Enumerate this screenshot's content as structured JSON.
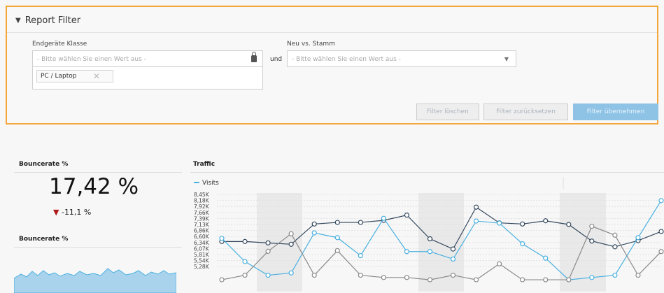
{
  "filter": {
    "title": "Report Filter",
    "endgeraete_label": "Endgeräte Klasse",
    "endgeraete_placeholder": "- Bitte wählen Sie einen Wert aus -",
    "endgeraete_chip": "PC / Laptop",
    "und_label": "und",
    "neu_label": "Neu vs. Stamm",
    "neu_placeholder": "- Bitte wählen Sie einen Wert aus -",
    "buttons": {
      "clear": "Filter löschen",
      "reset": "Filter zurücksetzen",
      "apply": "Filter übernehmen"
    }
  },
  "bounce_card": {
    "title": "Bouncerate %",
    "value": "17,42 %",
    "delta": "-11,1 %"
  },
  "bounce_mini": {
    "title": "Bouncerate %"
  },
  "traffic_card": {
    "title": "Traffic",
    "legend": "Visits"
  },
  "colors": {
    "accent_border": "#f4a63a",
    "series_dark": "#34495e",
    "series_blue": "#4ab0e0",
    "series_gray": "#8a8a8a",
    "delta_down": "#b01a1a"
  },
  "chart_data": {
    "type": "line",
    "title": "Traffic",
    "y_ticks": [
      "8,45K",
      "8,18K",
      "7,92K",
      "7,66K",
      "7,39K",
      "7,13K",
      "6,86K",
      "6,60K",
      "6,34K",
      "6,07K",
      "5,81K",
      "5,54K",
      "5,28K"
    ],
    "ylim": [
      5280,
      8450
    ],
    "series": [
      {
        "name": "Visits",
        "color": "#34495e",
        "values": [
          6380,
          6380,
          6320,
          6260,
          7150,
          7220,
          7220,
          7310,
          7540,
          6500,
          6050,
          7890,
          7200,
          7150,
          7290,
          7130,
          6400,
          6150,
          6420,
          6820
        ]
      },
      {
        "name": "",
        "color": "#4ab0e0",
        "values": [
          6520,
          5500,
          4900,
          5000,
          6760,
          6550,
          5760,
          7400,
          5940,
          5940,
          5610,
          7280,
          7190,
          6280,
          5650,
          4700,
          4800,
          4900,
          6550,
          8180
        ]
      },
      {
        "name": "",
        "color": "#8a8a8a",
        "values": [
          4700,
          4900,
          5950,
          6720,
          4900,
          5980,
          4900,
          4800,
          4800,
          4700,
          4900,
          4700,
          5400,
          4700,
          4700,
          4700,
          7050,
          6660,
          4900,
          5940
        ]
      }
    ]
  }
}
